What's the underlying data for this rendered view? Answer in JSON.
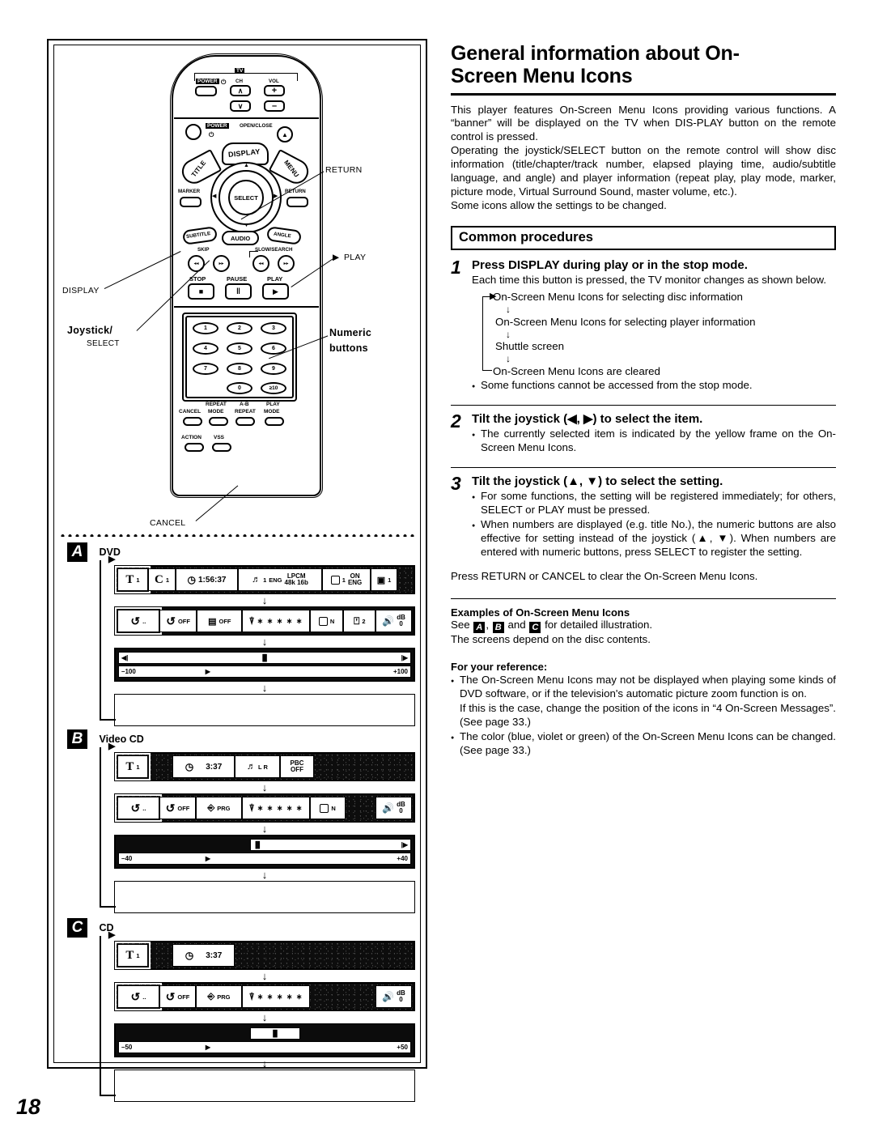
{
  "page": {
    "number": "18"
  },
  "article": {
    "title_line1": "General information about On-",
    "title_line2": "Screen Menu Icons",
    "intro_p1": "This player features On-Screen Menu Icons providing various functions. A “banner” will be displayed on the TV when DIS-PLAY button on the remote control is pressed.",
    "intro_p2": "Operating the joystick/SELECT button on the remote control will show disc information (title/chapter/track number, elapsed playing time, audio/subtitle language, and angle) and player information (repeat play, play mode, marker, picture mode, Virtual Surround Sound, master volume, etc.).",
    "intro_p3": "Some icons allow the settings to be changed."
  },
  "common_procedures": {
    "heading": "Common procedures",
    "steps": [
      {
        "number": "1",
        "title": "Press DISPLAY during play or in the stop mode.",
        "text": "Each time this button is pressed, the TV monitor changes as shown below.",
        "flow": [
          "On-Screen Menu Icons for selecting disc information",
          "On-Screen Menu Icons for selecting player information",
          "Shuttle screen",
          "On-Screen Menu Icons are cleared"
        ],
        "bullets": [
          "Some functions cannot be accessed from the stop mode."
        ]
      },
      {
        "number": "2",
        "title": "Tilt the joystick (◀, ▶) to select the item.",
        "bullets": [
          "The currently selected item is indicated by the yellow frame on the On-Screen Menu Icons."
        ]
      },
      {
        "number": "3",
        "title": "Tilt the joystick (▲, ▼) to select the setting.",
        "bullets": [
          "For some functions, the setting will be registered immediately; for others, SELECT or PLAY must be pressed.",
          "When numbers are displayed (e.g. title No.), the numeric buttons are also effective for setting instead of the joystick (▲, ▼). When numbers are entered with numeric buttons, press SELECT to register the setting."
        ]
      }
    ],
    "closing": "Press RETURN or CANCEL to clear the On-Screen Menu Icons."
  },
  "examples": {
    "heading": "Examples of On-Screen Menu Icons",
    "see_prefix": "See",
    "tag_a": "A",
    "tag_b": "B",
    "tag_c": "C",
    "see_mid": ",",
    "see_and": "and",
    "see_suffix": "for detailed illustration.",
    "note": "The screens depend on the disc contents."
  },
  "reference": {
    "heading": "For your reference:",
    "bullets": [
      "The On-Screen Menu Icons may not be displayed when playing some kinds of DVD software, or if the television's automatic picture zoom function is on.",
      "If this is the case, change the position of the icons in “4 On-Screen Messages”. (See page 33.)",
      "The color (blue, violet or green) of the On-Screen Menu Icons can be changed. (See page 33.)"
    ]
  },
  "remote": {
    "tv_label": "TV",
    "tv_power": "POWER",
    "tv_power_sym": "⏻",
    "ch": "CH",
    "vol": "VOL",
    "vol_plus": "+",
    "vol_minus": "–",
    "ch_up": "∧",
    "ch_down": "∨",
    "power": "POWER",
    "power_sym": "⏻",
    "open_close": "OPEN/CLOSE",
    "open_close_sym": "▲",
    "title": "TITLE",
    "display": "DISPLAY",
    "menu": "MENU",
    "marker": "MARKER",
    "select": "SELECT",
    "return": "RETURN",
    "subtitle": "SUBTITLE",
    "audio": "AUDIO",
    "angle": "ANGLE",
    "skip": "SKIP",
    "slow_search": "SLOW/SEARCH",
    "skip_back": "◂◂",
    "skip_fwd": "▸▸",
    "search_back": "◂◂",
    "search_fwd": "▸▸",
    "stop": "STOP",
    "pause": "PAUSE",
    "play": "PLAY",
    "stop_sym": "■",
    "pause_sym": "‖",
    "play_sym": "▶",
    "numbers": [
      "1",
      "2",
      "3",
      "4",
      "5",
      "6",
      "7",
      "8",
      "9"
    ],
    "zero": "0",
    "ten": "≥10",
    "cancel": "CANCEL",
    "repeat_mode_l1": "REPEAT",
    "repeat_mode_l2": "MODE",
    "ab_repeat_l1": "A-B",
    "ab_repeat_l2": "REPEAT",
    "play_mode_l1": "PLAY",
    "play_mode_l2": "MODE",
    "action": "ACTION",
    "vss": "VSS"
  },
  "callouts": {
    "display": "DISPLAY",
    "joystick_l1": "Joystick/",
    "joystick_l2": "SELECT",
    "cancel": "CANCEL",
    "return": "RETURN",
    "play": "PLAY",
    "play_arrow": "▶",
    "numeric_l1": "Numeric",
    "numeric_l2": "buttons"
  },
  "osd_examples": [
    {
      "tag": "A",
      "title": "DVD",
      "disc_row": {
        "title_no": "1",
        "title_icon": "T",
        "chapter_no": "1",
        "chapter_icon": "C",
        "time": "1:56:37",
        "audio_track": "1",
        "audio_lang": "ENG",
        "audio_fmt": "LPCM",
        "audio_rate": "48k 16b",
        "subtitle_no": "1",
        "subtitle_lang": "ENG",
        "subtitle_state": "ON",
        "angle_no": "1"
      },
      "player_row": {
        "repeat_a": "",
        "repeat_b": "OFF",
        "ab_repeat": "OFF",
        "marker": "∗ ∗ ∗ ∗ ∗",
        "picture": "N",
        "play_mode": "2",
        "volume_unit": "dB",
        "volume": "0"
      },
      "shuttle": {
        "left": "–100",
        "right": "+100"
      }
    },
    {
      "tag": "B",
      "title": "Video CD",
      "disc_row": {
        "track_no": "1",
        "track_icon": "T",
        "time": "3:37",
        "audio_lr": "L  R",
        "pbc_label": "PBC",
        "pbc_state": "OFF"
      },
      "player_row": {
        "repeat_b": "OFF",
        "program": "PRG",
        "marker": "∗ ∗ ∗ ∗ ∗",
        "picture": "N",
        "volume_unit": "dB",
        "volume": "0"
      },
      "shuttle": {
        "left": "–40",
        "right": "+40"
      }
    },
    {
      "tag": "C",
      "title": "CD",
      "disc_row": {
        "track_no": "1",
        "track_icon": "T",
        "time": "3:37"
      },
      "player_row": {
        "repeat_b": "OFF",
        "program": "PRG",
        "marker": "∗ ∗ ∗ ∗ ∗",
        "volume_unit": "dB",
        "volume": "0"
      },
      "shuttle": {
        "left": "–50",
        "right": "+50"
      }
    }
  ]
}
